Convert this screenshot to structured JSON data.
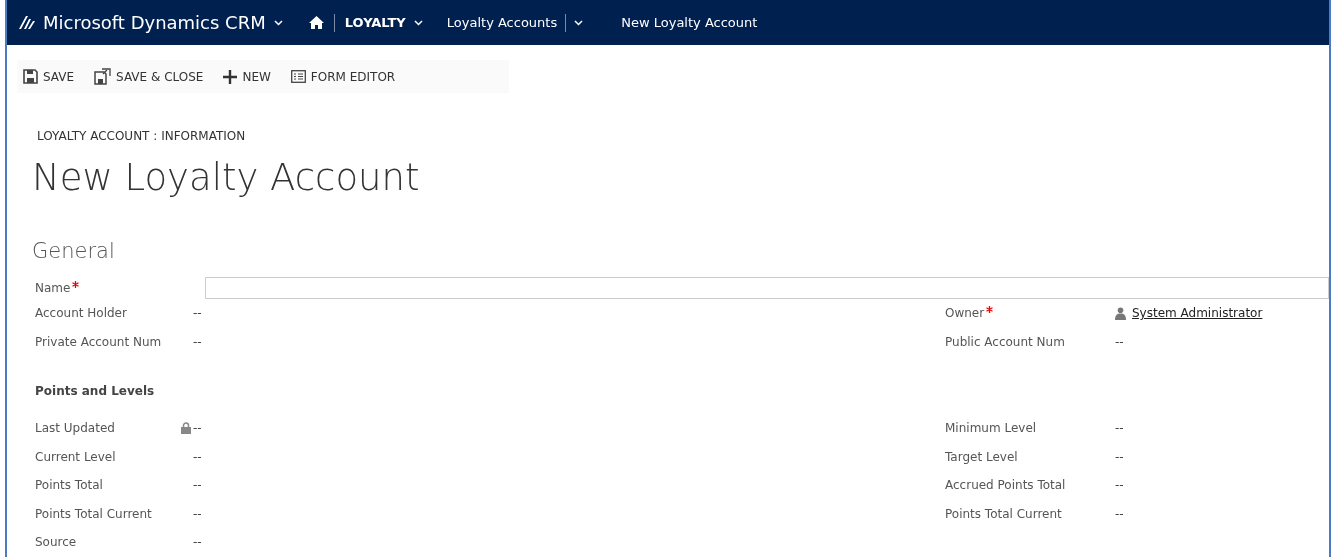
{
  "nav": {
    "app_title": "Microsoft Dynamics CRM",
    "area": "LOYALTY",
    "entity": "Loyalty Accounts",
    "record": "New Loyalty Account"
  },
  "commands": [
    {
      "kind": "save",
      "label": "SAVE"
    },
    {
      "kind": "save_close",
      "label": "SAVE & CLOSE"
    },
    {
      "kind": "new",
      "label": "NEW"
    },
    {
      "kind": "form_editor",
      "label": "FORM EDITOR"
    }
  ],
  "breadcrumb": "LOYALTY ACCOUNT : INFORMATION",
  "title": "New Loyalty Account",
  "section": {
    "title": "General",
    "name_field": {
      "label": "Name",
      "required": true
    },
    "rows": [
      {
        "left": {
          "label": "Account Holder",
          "value": "--",
          "kind": "text",
          "required": false,
          "locked": false
        },
        "right": {
          "label": "Owner",
          "value": "System Administrator",
          "kind": "lookup",
          "required": true,
          "locked": false
        }
      },
      {
        "left": {
          "label": "Private Account Num",
          "value": "--",
          "kind": "text",
          "required": false,
          "locked": false
        },
        "right": {
          "label": "Public Account Num",
          "value": "--",
          "kind": "text",
          "required": false,
          "locked": false
        }
      }
    ],
    "subsections": [
      {
        "title": "Points and Levels",
        "rows": [
          {
            "left": {
              "label": "Last Updated",
              "value": "--",
              "kind": "text",
              "required": false,
              "locked": true
            },
            "right": {
              "label": "Minimum Level",
              "value": "--",
              "kind": "text",
              "required": false,
              "locked": false
            }
          },
          {
            "left": {
              "label": "Current Level",
              "value": "--",
              "kind": "text",
              "required": false,
              "locked": false
            },
            "right": {
              "label": "Target Level",
              "value": "--",
              "kind": "text",
              "required": false,
              "locked": false
            }
          },
          {
            "left": {
              "label": "Points Total",
              "value": "--",
              "kind": "text",
              "required": false,
              "locked": false
            },
            "right": {
              "label": "Accrued Points Total",
              "value": "--",
              "kind": "text",
              "required": false,
              "locked": false
            }
          },
          {
            "left": {
              "label": "Points Total Current",
              "value": "--",
              "kind": "text",
              "required": false,
              "locked": false
            },
            "right": {
              "label": "Points Total Current",
              "value": "--",
              "kind": "text",
              "required": false,
              "locked": false
            }
          },
          {
            "left": {
              "label": "Source",
              "value": "--",
              "kind": "text",
              "required": false,
              "locked": false
            }
          }
        ]
      }
    ]
  }
}
